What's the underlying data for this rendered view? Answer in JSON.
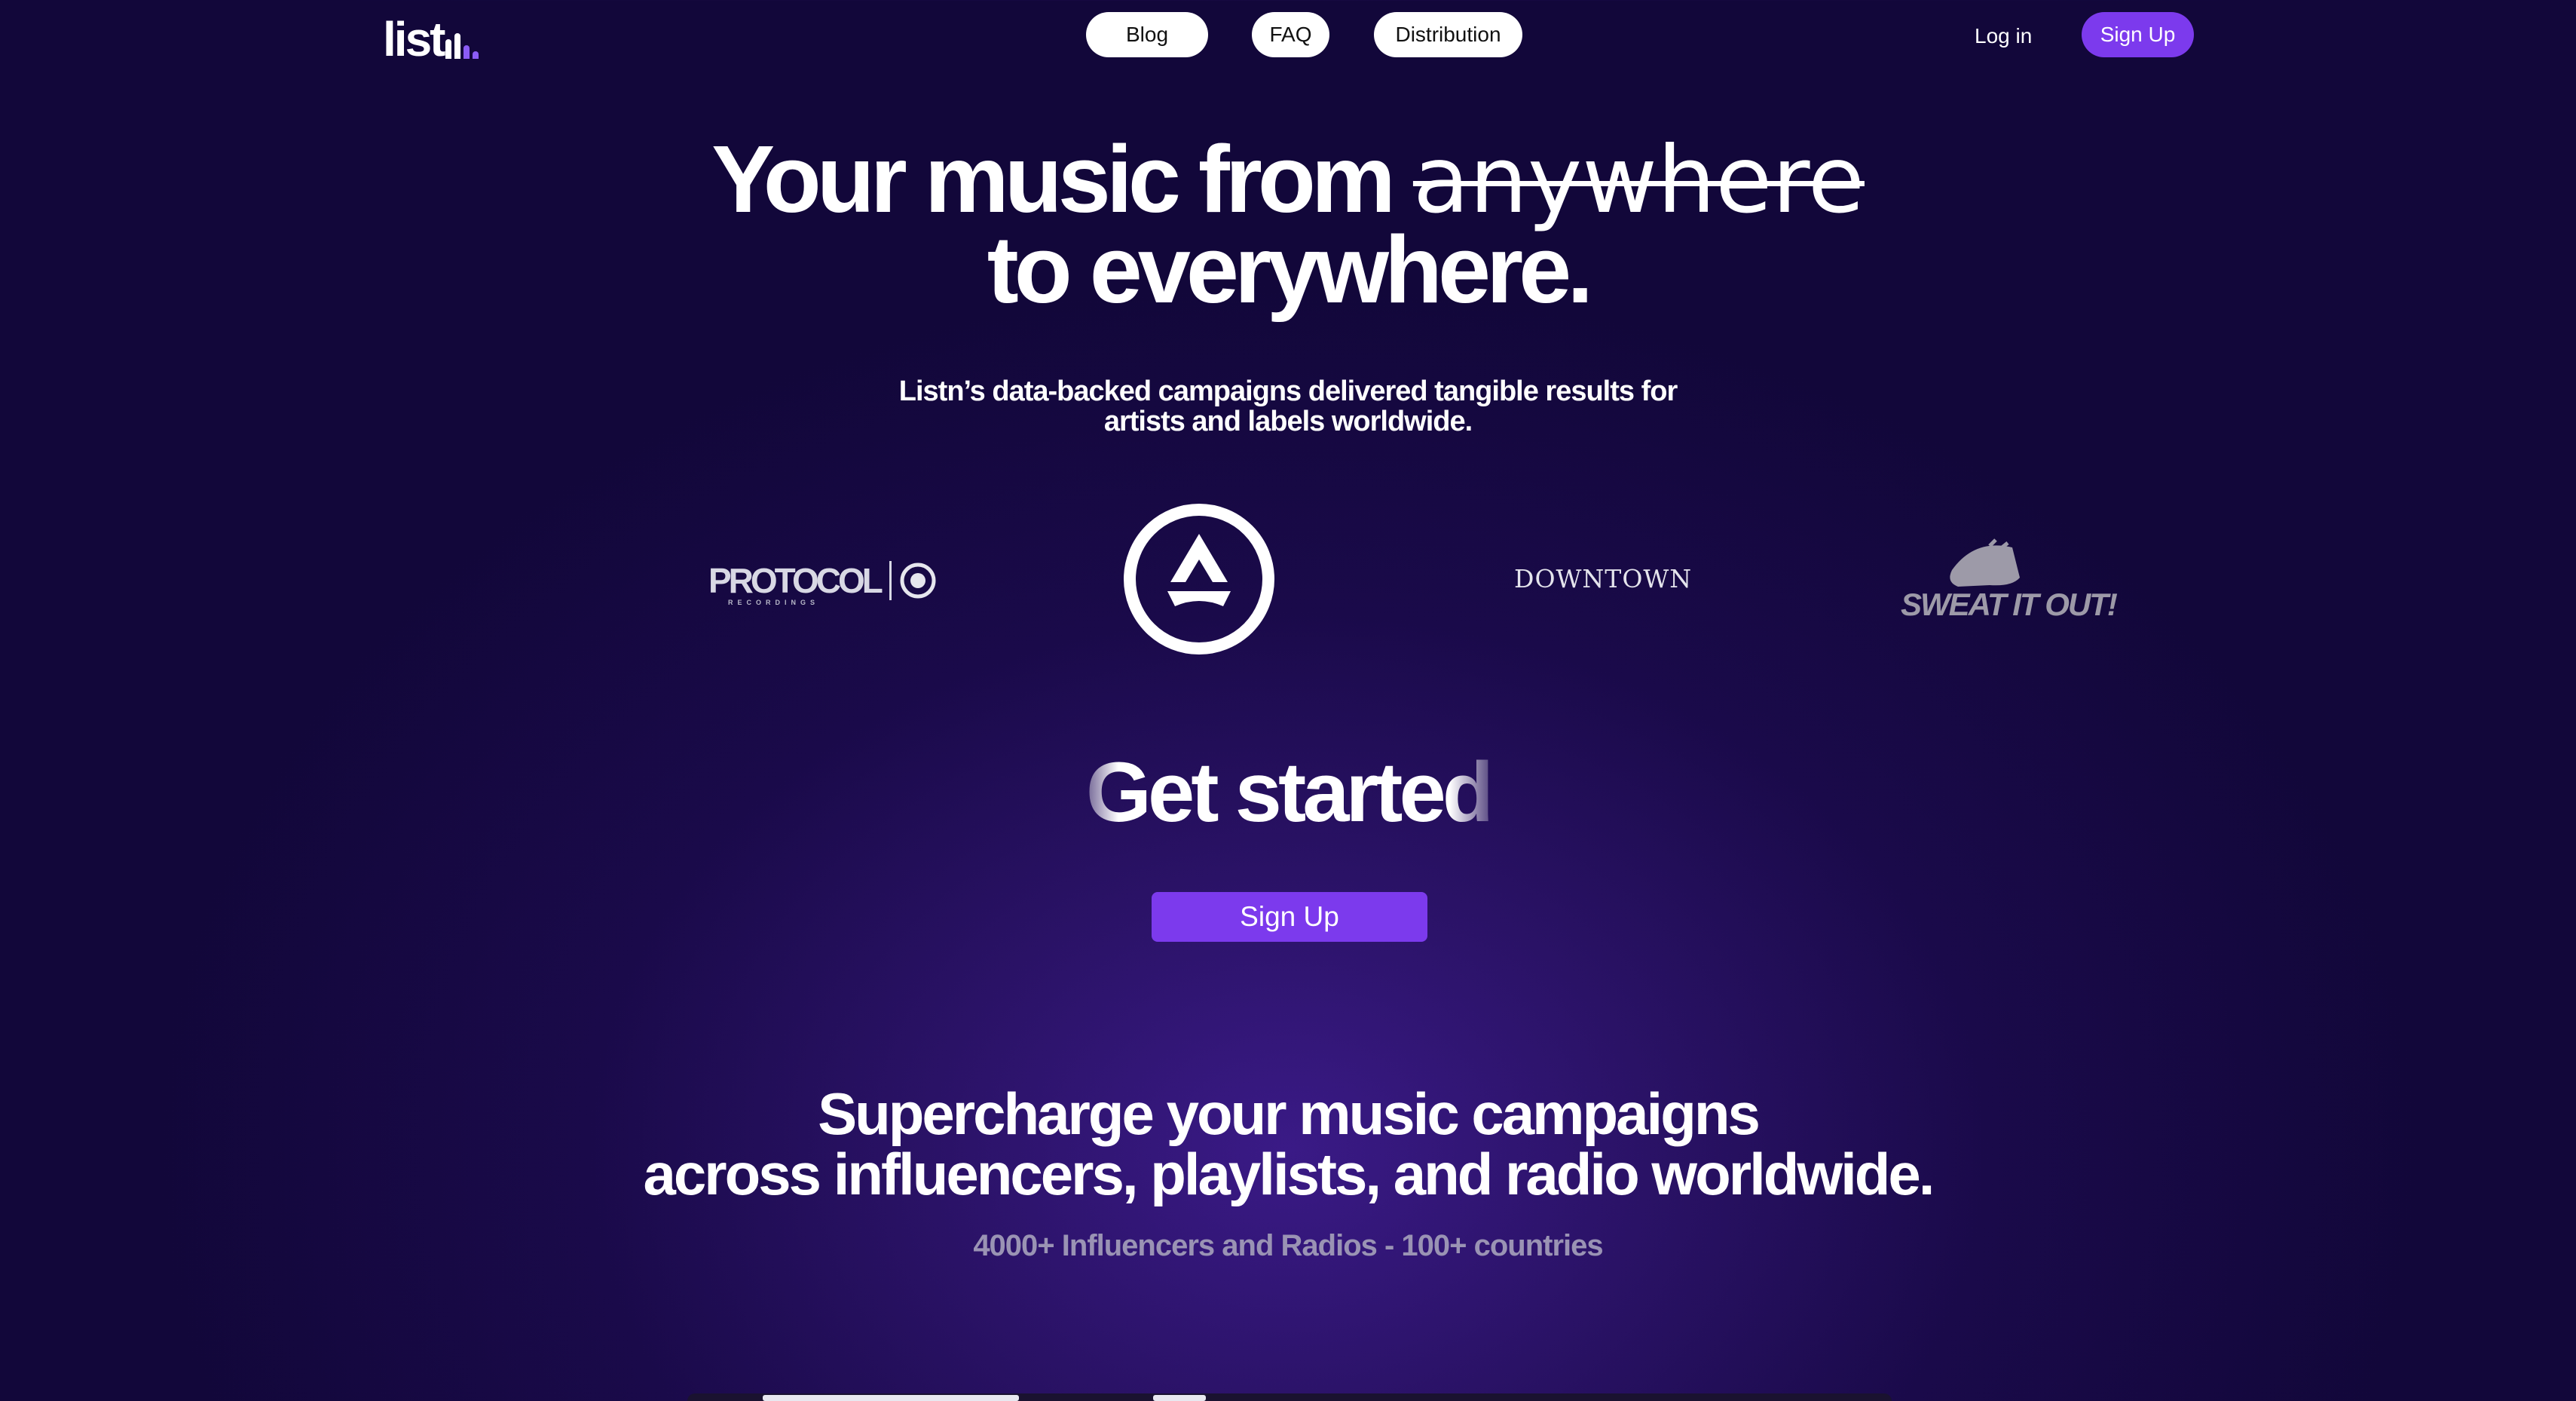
{
  "nav": {
    "logo_text": "list",
    "links": {
      "blog": "Blog",
      "faq": "FAQ",
      "distribution": "Distribution"
    },
    "login": "Log in",
    "signup": "Sign Up"
  },
  "hero": {
    "line1_prefix": "Your music from ",
    "line1_struck": "anywhere",
    "line2": "to everywhere.",
    "sub_line1": "Listn’s data-backed campaigns delivered tangible results for",
    "sub_line2": "artists and labels worldwide."
  },
  "logos": {
    "protocol": "PROTOCOL",
    "protocol_small": "RECORDINGS",
    "downtown": "DOWNTOWN",
    "sweat": "SWEAT IT OUT!"
  },
  "get_started": {
    "heading": "Get started",
    "cta": "Sign Up"
  },
  "supercharge": {
    "line1": "Supercharge your music campaigns",
    "line2": "across influencers, playlists, and radio worldwide.",
    "stat": "4000+ Influencers and Radios - 100+ countries"
  },
  "colors": {
    "accent": "#7c3aed",
    "background_dark": "#12073a",
    "background_glow": "#3a1a86"
  }
}
